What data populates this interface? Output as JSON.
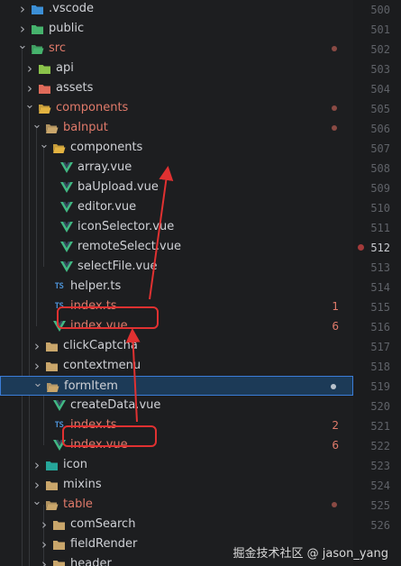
{
  "explorer": {
    "rows": [
      {
        "name": ".vscode",
        "type": "folder-vscode",
        "depth": 1,
        "expanded": false,
        "modified": false
      },
      {
        "name": "public",
        "type": "folder-public",
        "depth": 1,
        "expanded": false,
        "modified": false
      },
      {
        "name": "src",
        "type": "folder-src",
        "depth": 1,
        "expanded": true,
        "modified": true,
        "dot": true
      },
      {
        "name": "api",
        "type": "folder-api",
        "depth": 2,
        "expanded": false,
        "modified": false
      },
      {
        "name": "assets",
        "type": "folder-assets",
        "depth": 2,
        "expanded": false,
        "modified": false
      },
      {
        "name": "components",
        "type": "folder-components",
        "depth": 2,
        "expanded": true,
        "modified": true,
        "dot": true
      },
      {
        "name": "baInput",
        "type": "folder-open",
        "depth": 3,
        "expanded": true,
        "modified": true,
        "dot": true
      },
      {
        "name": "components",
        "type": "folder-components",
        "depth": 4,
        "expanded": true,
        "modified": false
      },
      {
        "name": "array.vue",
        "type": "vue",
        "depth": 5
      },
      {
        "name": "baUpload.vue",
        "type": "vue",
        "depth": 5
      },
      {
        "name": "editor.vue",
        "type": "vue",
        "depth": 5
      },
      {
        "name": "iconSelector.vue",
        "type": "vue",
        "depth": 5
      },
      {
        "name": "remoteSelect.vue",
        "type": "vue",
        "depth": 5
      },
      {
        "name": "selectFile.vue",
        "type": "vue",
        "depth": 5
      },
      {
        "name": "helper.ts",
        "type": "ts",
        "depth": 4
      },
      {
        "name": "index.ts",
        "type": "ts",
        "depth": 4,
        "modified": true,
        "badge": "1"
      },
      {
        "name": "index.vue",
        "type": "vue",
        "depth": 4,
        "modified": true,
        "badge": "6"
      },
      {
        "name": "clickCaptcha",
        "type": "folder",
        "depth": 3,
        "expanded": false
      },
      {
        "name": "contextmenu",
        "type": "folder",
        "depth": 3,
        "expanded": false
      },
      {
        "name": "formItem",
        "type": "folder-open",
        "depth": 3,
        "expanded": true,
        "modified": false,
        "selected": true,
        "dot": true
      },
      {
        "name": "createData.vue",
        "type": "vue",
        "depth": 4
      },
      {
        "name": "index.ts",
        "type": "ts",
        "depth": 4,
        "modified": true,
        "badge": "2"
      },
      {
        "name": "index.vue",
        "type": "vue",
        "depth": 4,
        "modified": true,
        "badge": "6"
      },
      {
        "name": "icon",
        "type": "folder-icon",
        "depth": 3,
        "expanded": false
      },
      {
        "name": "mixins",
        "type": "folder",
        "depth": 3,
        "expanded": false
      },
      {
        "name": "table",
        "type": "folder-open",
        "depth": 3,
        "expanded": true,
        "modified": true,
        "dot": true
      },
      {
        "name": "comSearch",
        "type": "folder",
        "depth": 4,
        "expanded": false
      },
      {
        "name": "fieldRender",
        "type": "folder",
        "depth": 4,
        "expanded": false
      },
      {
        "name": "header",
        "type": "folder",
        "depth": 4,
        "expanded": false
      }
    ]
  },
  "gutter": {
    "lines": [
      "500",
      "501",
      "502",
      "503",
      "504",
      "505",
      "506",
      "507",
      "508",
      "509",
      "510",
      "511",
      "512",
      "513",
      "514",
      "515",
      "516",
      "517",
      "518",
      "519",
      "520",
      "521",
      "522",
      "523",
      "524",
      "525",
      "526"
    ],
    "current": "512",
    "breakpoint": "512"
  },
  "colors": {
    "background": "#1d1e20",
    "modified": "#e07a6a",
    "vue": "#41b883",
    "ts": "#4b8fd1",
    "selection_border": "#3b7dd8",
    "annotation": "#e03131"
  },
  "watermark": "掘金技术社区 @ jason_yang"
}
